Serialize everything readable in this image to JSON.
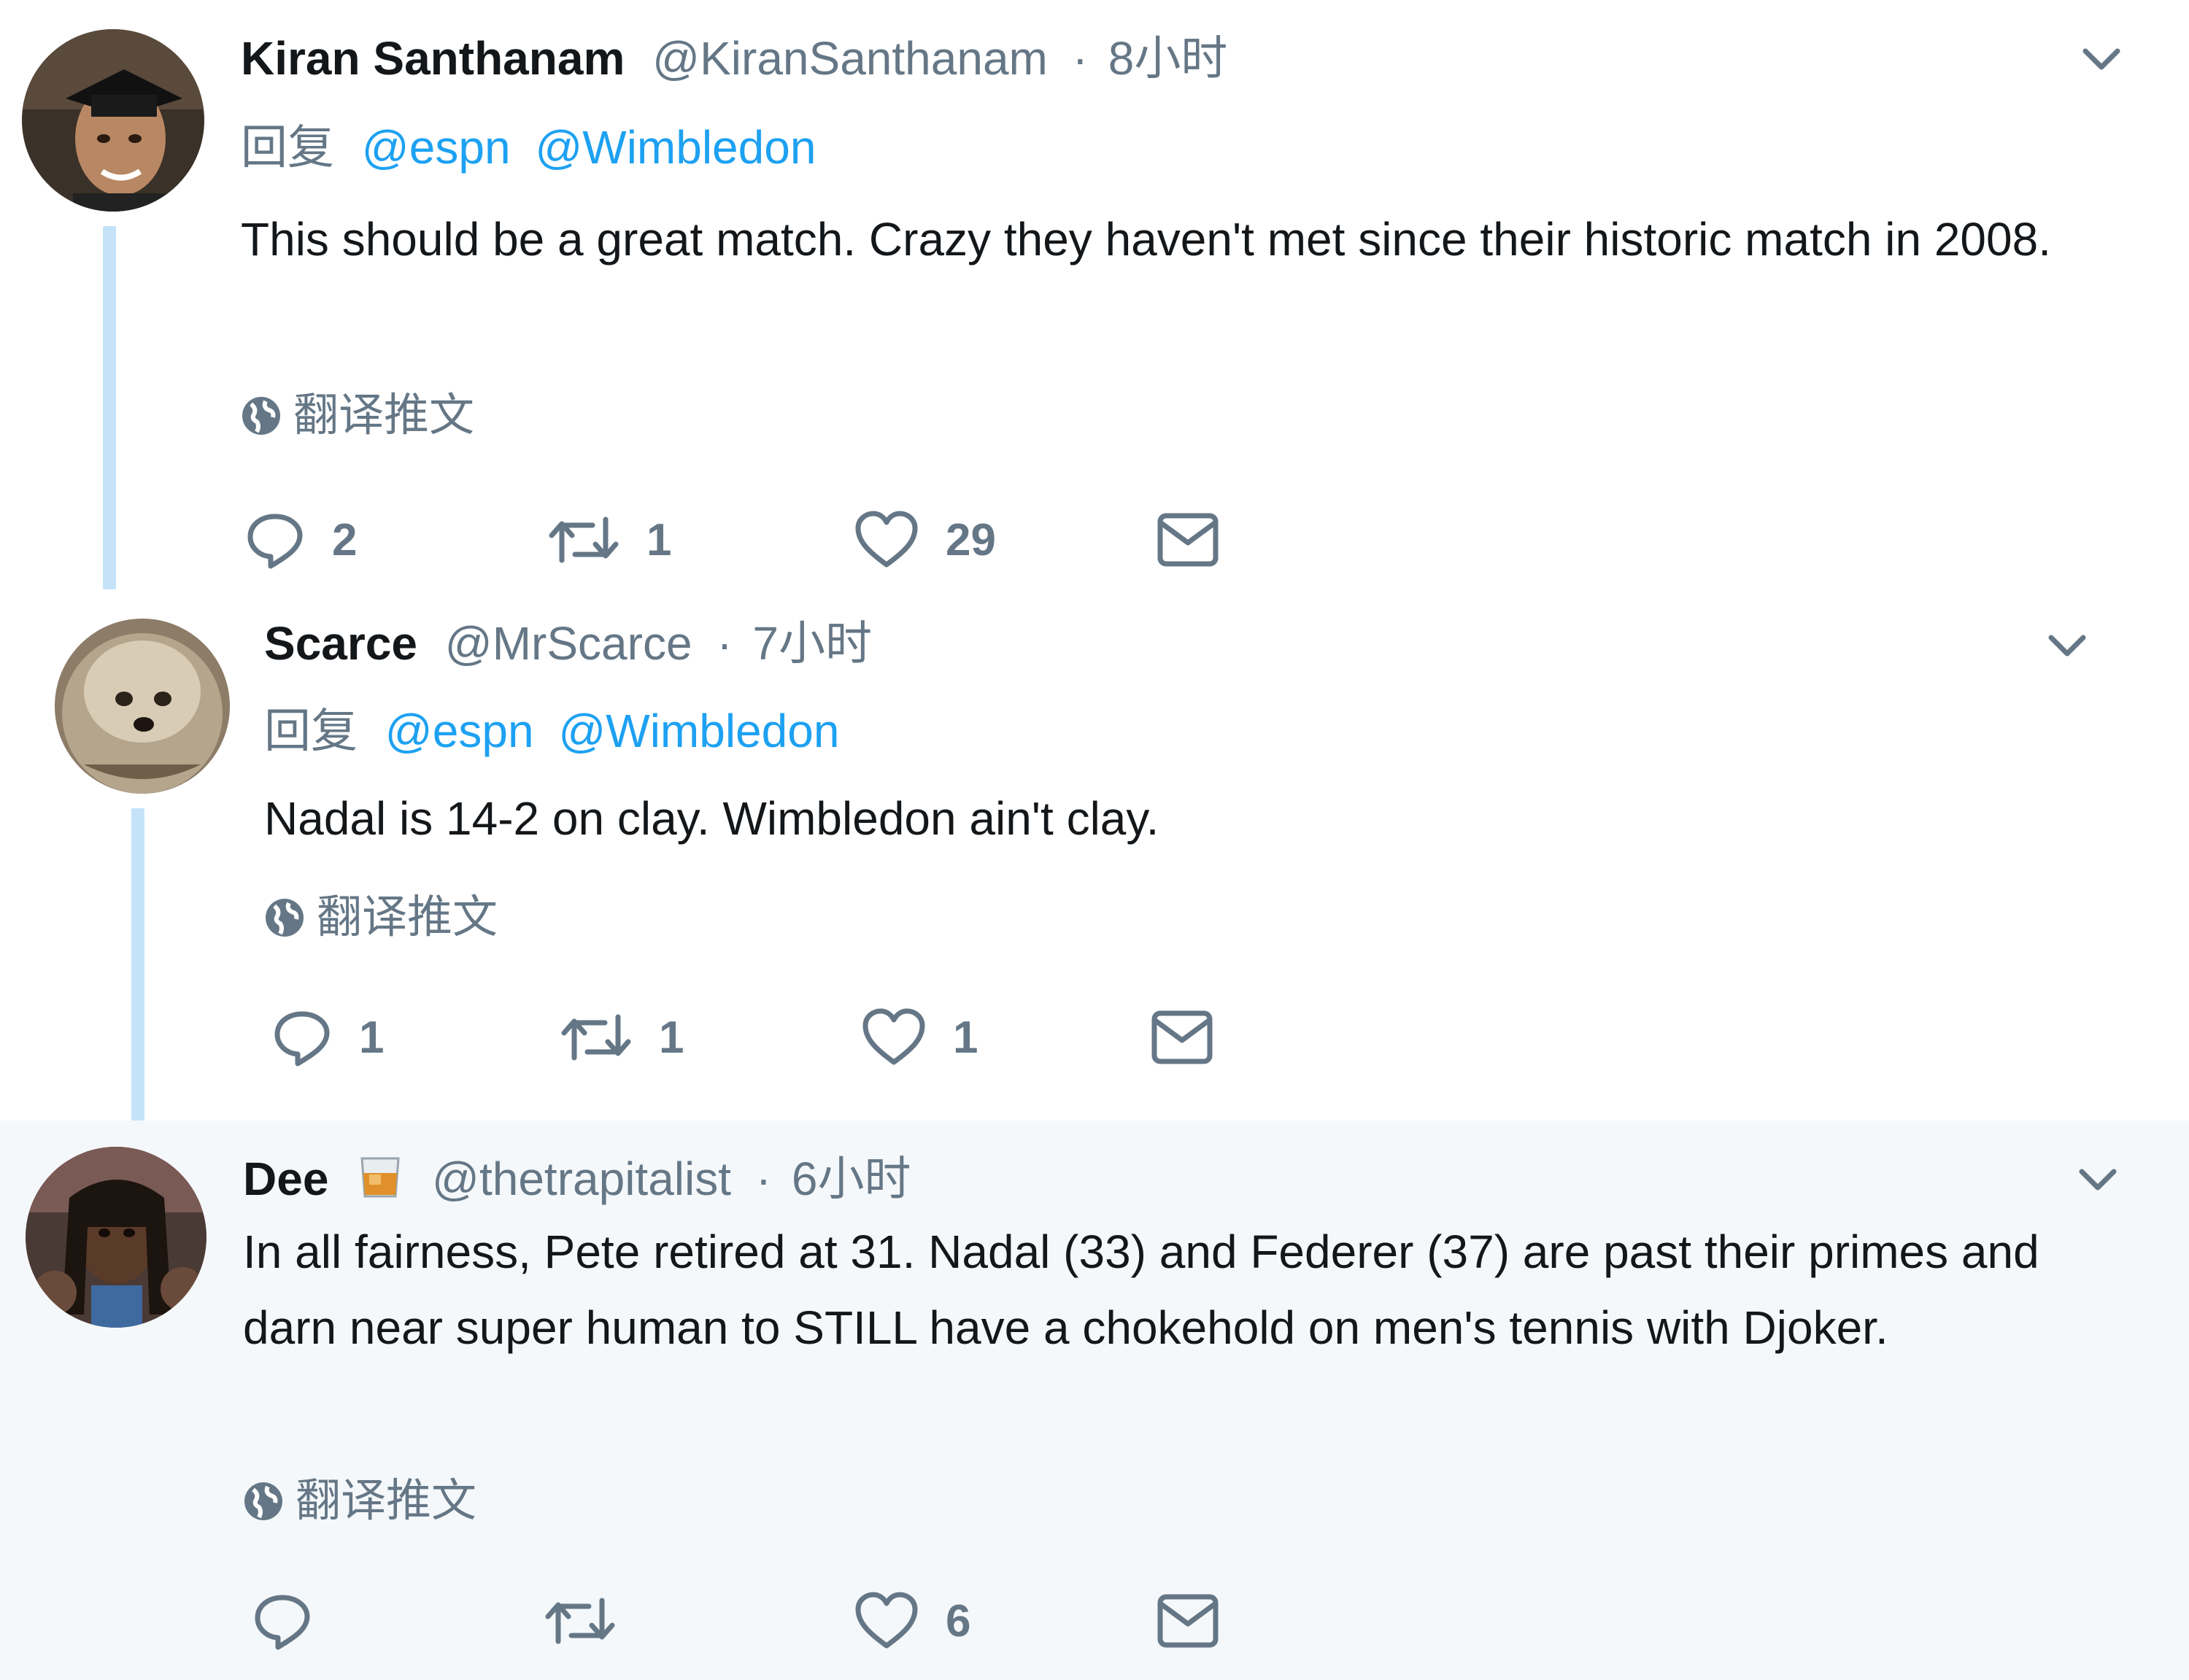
{
  "tweets": [
    {
      "name": "Kiran Santhanam",
      "handle": "@KiranSanthanam",
      "separator": "·",
      "time": "8小时",
      "reply_prefix": "回复",
      "mentions": [
        "@espn",
        "@Wimbledon"
      ],
      "text": "This should be a great match. Crazy they haven't met since their historic match in 2008.",
      "translate_label": "翻译推文",
      "reply_count": "2",
      "retweet_count": "1",
      "like_count": "29"
    },
    {
      "name": "Scarce",
      "handle": "@MrScarce",
      "separator": "·",
      "time": "7小时",
      "reply_prefix": "回复",
      "mentions": [
        "@espn",
        "@Wimbledon"
      ],
      "text": "Nadal is 14-2 on clay. Wimbledon ain't clay.",
      "translate_label": "翻译推文",
      "reply_count": "1",
      "retweet_count": "1",
      "like_count": "1"
    },
    {
      "name": "Dee",
      "name_emoji": "whisky-glass-icon",
      "handle": "@thetrapitalist",
      "separator": "·",
      "time": "6小时",
      "text": "In all fairness, Pete retired at 31. Nadal (33) and Federer (37) are past their primes and darn near super human to STILL have a chokehold on men's tennis with Djoker.",
      "translate_label": "翻译推文",
      "reply_count": "",
      "retweet_count": "",
      "like_count": "6"
    }
  ],
  "colors": {
    "link": "#1da1f2",
    "secondary_text": "#657786",
    "thread_line": "#c4e3f9",
    "highlight_bg": "#f5f8fa"
  }
}
